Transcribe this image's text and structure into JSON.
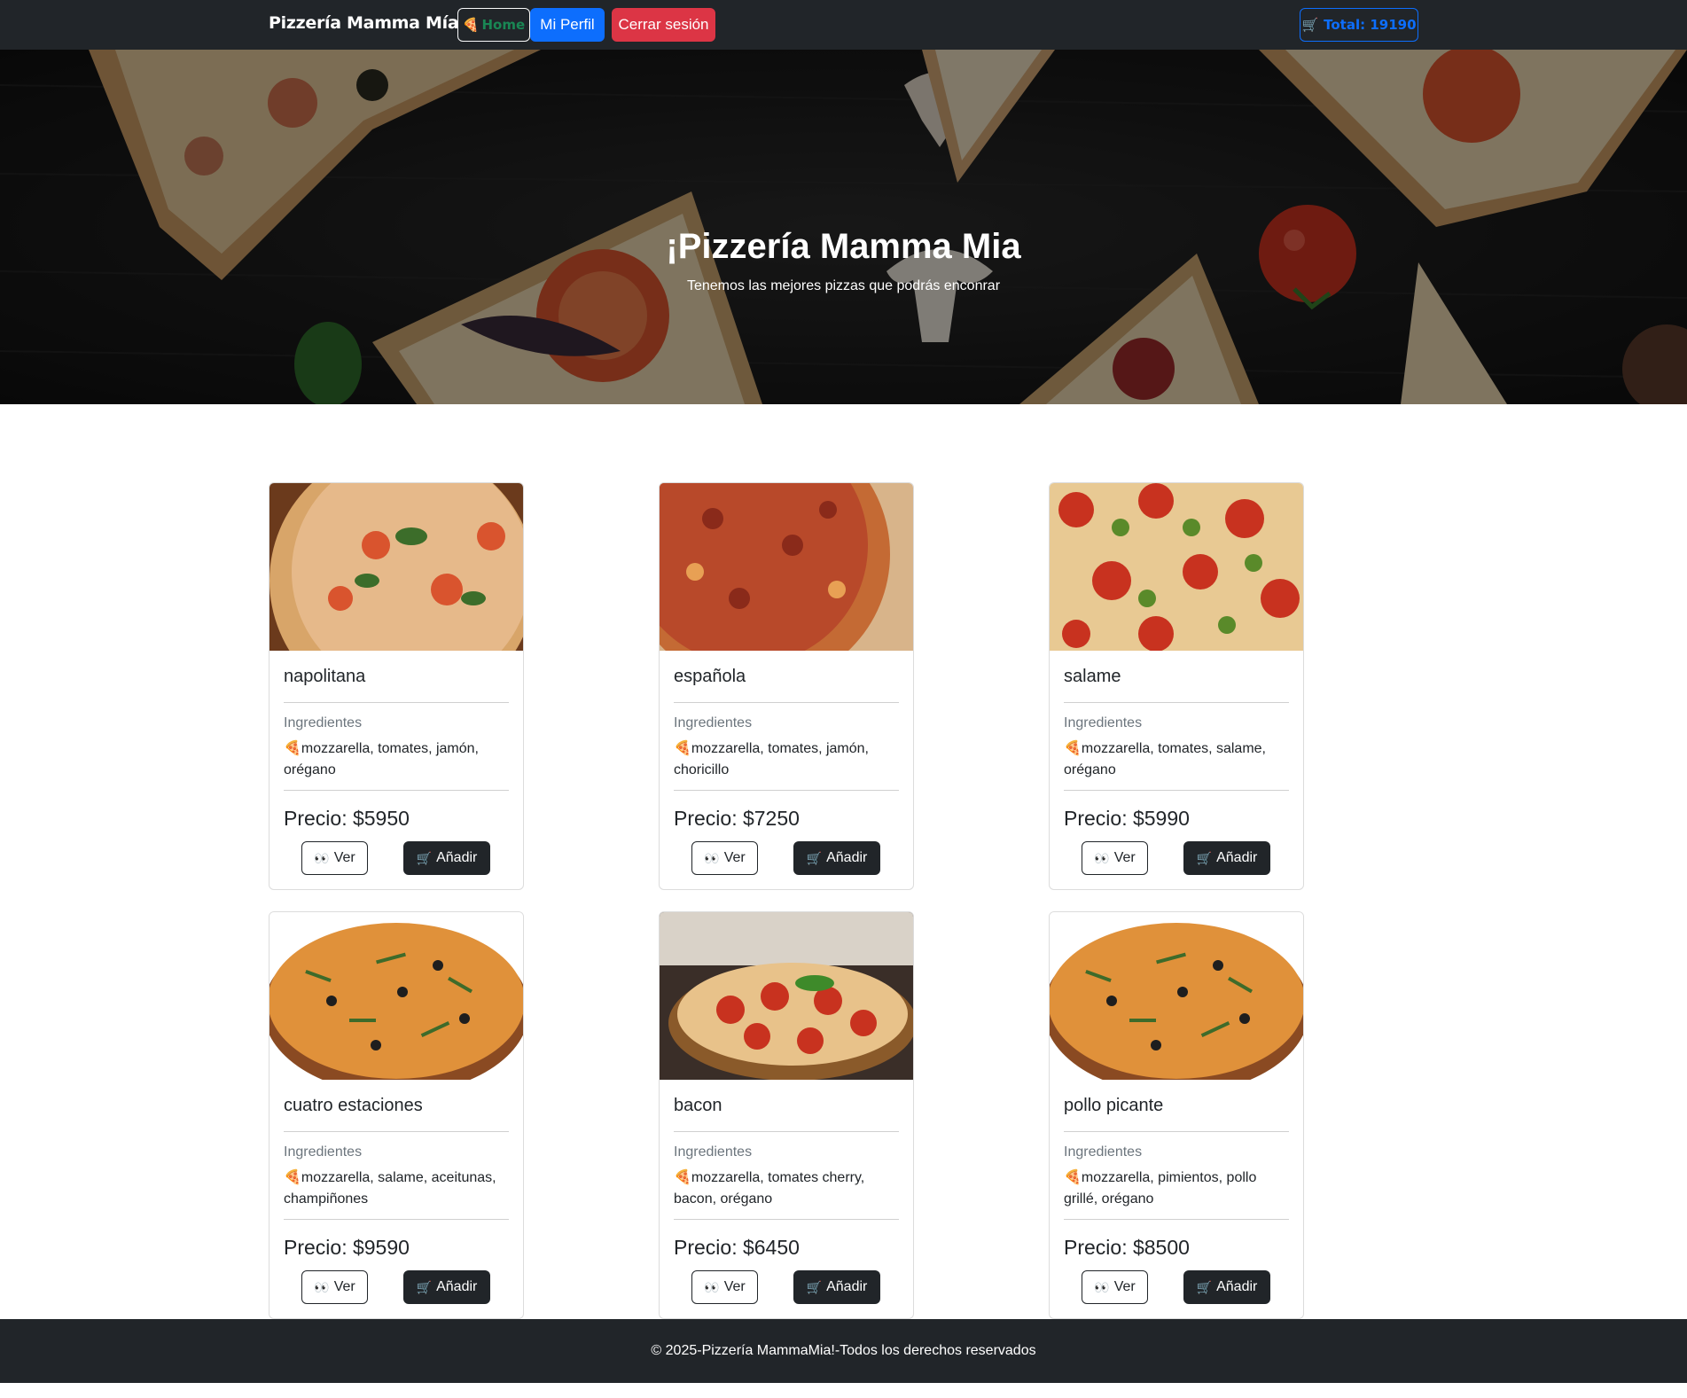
{
  "navbar": {
    "brand": "Pizzería Mamma Mía",
    "home_label": "Home",
    "home_icon": "🍕",
    "profile_label": "Mi Perfil",
    "logout_label": "Cerrar sesión",
    "total_label": "Total: 19190",
    "cart_icon": "🛒"
  },
  "hero": {
    "title": "¡Pizzería Mamma Mia",
    "subtitle": "Tenemos las mejores pizzas que podrás enconrar"
  },
  "labels": {
    "ingredients": "Ingredientes",
    "view": "Ver",
    "add": "Añadir",
    "view_icon": "👀",
    "add_icon": "🛒",
    "ingredient_icon": "🍕"
  },
  "pizzas": [
    {
      "name": "napolitana",
      "ingredients": "mozzarella, tomates, jamón, orégano",
      "price": "Precio: $5950"
    },
    {
      "name": "española",
      "ingredients": "mozzarella, tomates, jamón, choricillo",
      "price": "Precio: $7250"
    },
    {
      "name": "salame",
      "ingredients": "mozzarella, tomates, salame, orégano",
      "price": "Precio: $5990"
    },
    {
      "name": "cuatro estaciones",
      "ingredients": "mozzarella, salame, aceitunas, champiñones",
      "price": "Precio: $9590"
    },
    {
      "name": "bacon",
      "ingredients": "mozzarella, tomates cherry, bacon, orégano",
      "price": "Precio: $6450"
    },
    {
      "name": "pollo picante",
      "ingredients": "mozzarella, pimientos, pollo grillé, orégano",
      "price": "Precio: $8500"
    }
  ],
  "footer": {
    "text": "© 2025-Pizzería MammaMia!-Todos los derechos reservados"
  },
  "colors": {
    "navbar": "#212529",
    "primary": "#0d6efd",
    "danger": "#dc3545",
    "success": "#198754"
  }
}
